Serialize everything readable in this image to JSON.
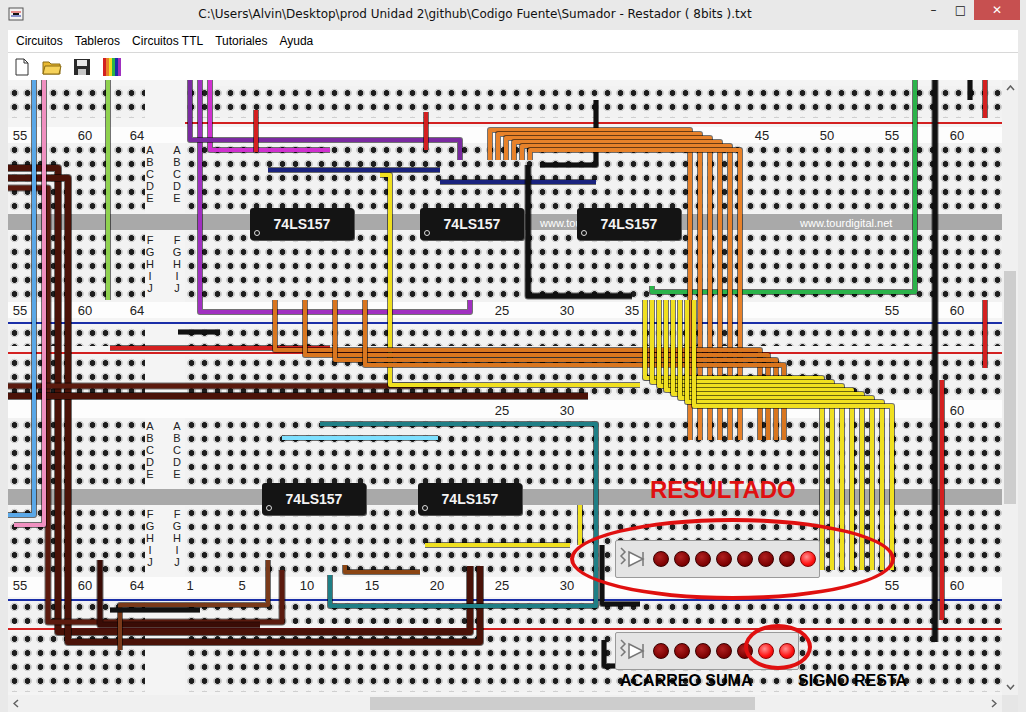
{
  "window": {
    "title": "C:\\Users\\Alvin\\Desktop\\prod Unidad 2\\github\\Codigo Fuente\\Sumador - Restador ( 8bits ).txt",
    "controls": [
      "–",
      "□",
      "✕"
    ]
  },
  "menu": [
    "Circuitos",
    "Tableros",
    "Circuitos TTL",
    "Tutoriales",
    "Ayuda"
  ],
  "board": {
    "number_rows": [
      {
        "left": [
          "55",
          "60",
          "64"
        ],
        "right": [
          "45",
          "50",
          "55",
          "60"
        ]
      },
      {
        "left": [
          "55",
          "60",
          "64"
        ],
        "right": [
          "25",
          "30",
          "35",
          "55",
          "60"
        ]
      },
      {
        "left": [],
        "right": [
          "25",
          "30",
          "60"
        ]
      },
      {
        "left": [
          "55",
          "60",
          "64"
        ],
        "right": [
          "1",
          "5",
          "10",
          "15",
          "20",
          "25",
          "30",
          "55",
          "60"
        ]
      }
    ],
    "row_letters": {
      "upper": [
        "A",
        "B",
        "C",
        "D",
        "E"
      ],
      "lower": [
        "F",
        "G",
        "H",
        "I",
        "J"
      ]
    },
    "watermark": "www.tourdigital.net"
  },
  "chips": [
    {
      "label": "74LS157"
    },
    {
      "label": "74LS157"
    },
    {
      "label": "74LS157"
    },
    {
      "label": "74LS157"
    },
    {
      "label": "74LS157"
    }
  ],
  "displays": [
    {
      "title": "RESULTADO",
      "leds": [
        {
          "on": false
        },
        {
          "on": false
        },
        {
          "on": false
        },
        {
          "on": false
        },
        {
          "on": false
        },
        {
          "on": false
        },
        {
          "on": false
        },
        {
          "on": true
        }
      ]
    },
    {
      "captions": [
        "ACARREO SUMA",
        "SIGNO RESTA"
      ],
      "leds": [
        {
          "on": false
        },
        {
          "on": false
        },
        {
          "on": false
        },
        {
          "on": false
        },
        {
          "on": false
        },
        {
          "on": true
        },
        {
          "on": true
        }
      ]
    }
  ],
  "scrollbars": {
    "vertical": {
      "level": 0.5
    },
    "horizontal": {
      "level": 0.6
    }
  }
}
